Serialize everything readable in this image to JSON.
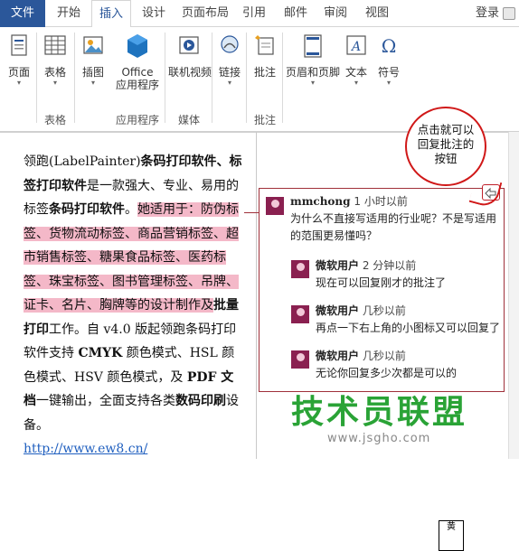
{
  "tabs": [
    {
      "label": "文件"
    },
    {
      "label": "开始"
    },
    {
      "label": "插入"
    },
    {
      "label": "设计"
    },
    {
      "label": "页面布局"
    },
    {
      "label": "引用"
    },
    {
      "label": "邮件"
    },
    {
      "label": "审阅"
    },
    {
      "label": "视图"
    }
  ],
  "login_label": "登录",
  "ribbon": {
    "buttons": [
      {
        "label": "页面",
        "icon": "page-icon",
        "dropdown": true
      },
      {
        "label": "表格",
        "icon": "table-icon",
        "dropdown": true
      },
      {
        "label": "插图",
        "icon": "illustration-icon",
        "dropdown": true
      },
      {
        "label": "Office",
        "label2": "应用程序",
        "icon": "office-app-icon",
        "dropdown": true
      },
      {
        "label": "联机视频",
        "icon": "online-video-icon",
        "dropdown": false
      },
      {
        "label": "链接",
        "icon": "link-icon",
        "dropdown": true
      },
      {
        "label": "批注",
        "icon": "comment-icon",
        "dropdown": false
      },
      {
        "label": "页眉和页脚",
        "icon": "header-footer-icon",
        "dropdown": true
      },
      {
        "label": "文本",
        "icon": "text-icon",
        "dropdown": true
      },
      {
        "label": "符号",
        "icon": "symbol-icon",
        "dropdown": true
      }
    ],
    "groups": [
      {
        "label": "表格"
      },
      {
        "label": "应用程序"
      },
      {
        "label": "媒体"
      },
      {
        "label": "批注"
      }
    ]
  },
  "document": {
    "p1": "领跑(LabelPainter)",
    "p1b": "条码打印软件、标签打印软件",
    "p2": "是一款强大、专业、易用的标签",
    "p2b": "条码打印软件",
    "p3": "。",
    "highlight": "她适用于：防伪标签、货物流动标签、商品营销标签、超市销售标签、糖果食品标签、医药标签、珠宝标签、图书管理标签、吊牌、证卡、名片、胸牌等的设计制作及",
    "hl_bold": "批量打印",
    "after_hl": "工作。",
    "p4": "自 v4.0 版起领跑条码打印软件支持 ",
    "p4b": "CMYK",
    "p5": " 颜色模式、HSL 颜色模式、HSV 颜色模式，及 ",
    "p5b": "PDF 文档",
    "p6": "一键输出，全面支持各类",
    "p6b": "数码印刷",
    "p7": "设备。",
    "link": "http://www.ew8.cn/"
  },
  "comments": [
    {
      "author": "mmchong",
      "time": "1 小时以前",
      "text": "为什么不直接写适用的行业呢？不是写适用的范围更易懂吗？"
    },
    {
      "author": "微软用户",
      "time": "2 分钟以前",
      "text": "现在可以回复刚才的批注了"
    },
    {
      "author": "微软用户",
      "time": "几秒以前",
      "text": "再点一下右上角的小图标又可以回复了"
    },
    {
      "author": "微软用户",
      "time": "几秒以前",
      "text": "无论你回复多少次都是可以的"
    }
  ],
  "callout": {
    "line1": "点击就可以",
    "line2": "回复批注的",
    "line3": "按钮"
  },
  "watermark": {
    "title": "技术员联盟",
    "url": "www.jsgho.com"
  },
  "cursor_char": "黄",
  "colors": {
    "file_tab": "#2b579a",
    "highlight": "#f4b8c8",
    "comment_border": "#a0303a",
    "callout": "#d01818",
    "watermark": "#2aa336"
  }
}
